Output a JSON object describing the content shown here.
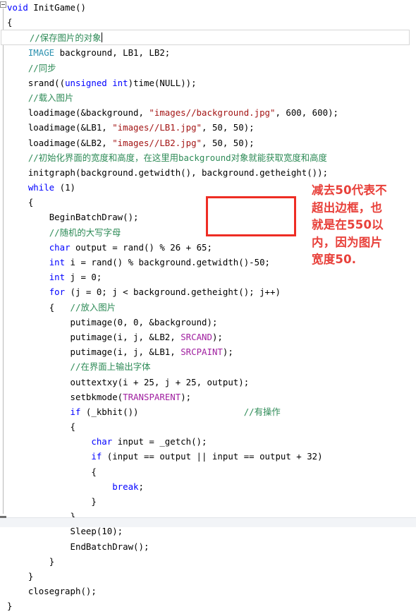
{
  "editor": {
    "language": "cpp",
    "colors": {
      "keyword": "#0000ff",
      "type": "#2b91af",
      "comment": "#2e8b57",
      "string": "#a31515",
      "macro": "#a020a0",
      "plain": "#000000",
      "annotation_red": "#e8403a",
      "highlight_border": "#d7d7d7",
      "background": "#ffffff"
    },
    "fold_icon": "collapse-minus-box-icon",
    "caret_line_index": 2
  },
  "code_lines": [
    {
      "indent": 0,
      "tokens": [
        {
          "t": "kw",
          "s": "void"
        },
        {
          "t": "plain",
          "s": " InitGame()"
        }
      ]
    },
    {
      "indent": 0,
      "tokens": [
        {
          "t": "plain",
          "s": "{"
        }
      ]
    },
    {
      "indent": 1,
      "current": true,
      "caret": true,
      "tokens": [
        {
          "t": "cmt",
          "s": "//保存图片的对象"
        }
      ]
    },
    {
      "indent": 1,
      "tokens": [
        {
          "t": "type",
          "s": "IMAGE"
        },
        {
          "t": "plain",
          "s": " background, LB1, LB2;"
        }
      ]
    },
    {
      "indent": 1,
      "tokens": [
        {
          "t": "cmt",
          "s": "//同步"
        }
      ]
    },
    {
      "indent": 1,
      "tokens": [
        {
          "t": "plain",
          "s": "srand(("
        },
        {
          "t": "kw",
          "s": "unsigned"
        },
        {
          "t": "plain",
          "s": " "
        },
        {
          "t": "kw",
          "s": "int"
        },
        {
          "t": "plain",
          "s": ")time(NULL));"
        }
      ]
    },
    {
      "indent": 1,
      "tokens": [
        {
          "t": "cmt",
          "s": "//载入图片"
        }
      ]
    },
    {
      "indent": 1,
      "tokens": [
        {
          "t": "plain",
          "s": "loadimage(&background, "
        },
        {
          "t": "str",
          "s": "\"images//background.jpg\""
        },
        {
          "t": "plain",
          "s": ", 600, 600);"
        }
      ]
    },
    {
      "indent": 1,
      "tokens": [
        {
          "t": "plain",
          "s": "loadimage(&LB1, "
        },
        {
          "t": "str",
          "s": "\"images//LB1.jpg\""
        },
        {
          "t": "plain",
          "s": ", 50, 50);"
        }
      ]
    },
    {
      "indent": 1,
      "tokens": [
        {
          "t": "plain",
          "s": "loadimage(&LB2, "
        },
        {
          "t": "str",
          "s": "\"images//LB2.jpg\""
        },
        {
          "t": "plain",
          "s": ", 50, 50);"
        }
      ]
    },
    {
      "indent": 1,
      "tokens": [
        {
          "t": "cmt",
          "s": "//初始化界面的宽度和高度，在这里用background对象就能获取宽度和高度"
        }
      ]
    },
    {
      "indent": 1,
      "tokens": [
        {
          "t": "plain",
          "s": "initgraph(background.getwidth(), background.getheight());"
        }
      ]
    },
    {
      "indent": 1,
      "tokens": [
        {
          "t": "kw",
          "s": "while"
        },
        {
          "t": "plain",
          "s": " (1)"
        }
      ]
    },
    {
      "indent": 1,
      "tokens": [
        {
          "t": "plain",
          "s": "{"
        }
      ]
    },
    {
      "indent": 2,
      "tokens": [
        {
          "t": "plain",
          "s": "BeginBatchDraw();"
        }
      ]
    },
    {
      "indent": 2,
      "tokens": [
        {
          "t": "cmt",
          "s": "//随机的大写字母"
        }
      ]
    },
    {
      "indent": 2,
      "tokens": [
        {
          "t": "kw",
          "s": "char"
        },
        {
          "t": "plain",
          "s": " output = rand() % 26 + 65;"
        }
      ]
    },
    {
      "indent": 2,
      "tokens": [
        {
          "t": "kw",
          "s": "int"
        },
        {
          "t": "plain",
          "s": " i = rand() % background.getwidth()-50;"
        }
      ]
    },
    {
      "indent": 2,
      "tokens": [
        {
          "t": "kw",
          "s": "int"
        },
        {
          "t": "plain",
          "s": " j = 0;"
        }
      ]
    },
    {
      "indent": 2,
      "tokens": [
        {
          "t": "kw",
          "s": "for"
        },
        {
          "t": "plain",
          "s": " (j = 0; j < background.getheight(); j++)"
        }
      ]
    },
    {
      "indent": 2,
      "tokens": [
        {
          "t": "plain",
          "s": "{   "
        },
        {
          "t": "cmt",
          "s": "//放入图片"
        }
      ]
    },
    {
      "indent": 3,
      "tokens": [
        {
          "t": "plain",
          "s": "putimage(0, 0, &background);"
        }
      ]
    },
    {
      "indent": 3,
      "tokens": [
        {
          "t": "plain",
          "s": "putimage(i, j, &LB2, "
        },
        {
          "t": "macro",
          "s": "SRCAND"
        },
        {
          "t": "plain",
          "s": ");"
        }
      ]
    },
    {
      "indent": 3,
      "tokens": [
        {
          "t": "plain",
          "s": "putimage(i, j, &LB1, "
        },
        {
          "t": "macro",
          "s": "SRCPAINT"
        },
        {
          "t": "plain",
          "s": ");"
        }
      ]
    },
    {
      "indent": 3,
      "tokens": [
        {
          "t": "cmt",
          "s": "//在界面上输出字体"
        }
      ]
    },
    {
      "indent": 3,
      "tokens": [
        {
          "t": "plain",
          "s": "outtextxy(i + 25, j + 25, output);"
        }
      ]
    },
    {
      "indent": 3,
      "tokens": [
        {
          "t": "plain",
          "s": "setbkmode("
        },
        {
          "t": "macro",
          "s": "TRANSPARENT"
        },
        {
          "t": "plain",
          "s": ");"
        }
      ]
    },
    {
      "indent": 3,
      "tokens": [
        {
          "t": "kw",
          "s": "if"
        },
        {
          "t": "plain",
          "s": " (_kbhit())"
        },
        {
          "t": "plain",
          "s": "                    "
        },
        {
          "t": "cmt",
          "s": "//有操作"
        }
      ]
    },
    {
      "indent": 3,
      "tokens": [
        {
          "t": "plain",
          "s": "{"
        }
      ]
    },
    {
      "indent": 4,
      "tokens": [
        {
          "t": "kw",
          "s": "char"
        },
        {
          "t": "plain",
          "s": " input = _getch();"
        }
      ]
    },
    {
      "indent": 4,
      "tokens": [
        {
          "t": "kw",
          "s": "if"
        },
        {
          "t": "plain",
          "s": " (input == output || input == output + 32)"
        }
      ]
    },
    {
      "indent": 4,
      "tokens": [
        {
          "t": "plain",
          "s": "{"
        }
      ]
    },
    {
      "indent": 5,
      "tokens": [
        {
          "t": "kw",
          "s": "break"
        },
        {
          "t": "plain",
          "s": ";"
        }
      ]
    },
    {
      "indent": 4,
      "tokens": [
        {
          "t": "plain",
          "s": "}"
        }
      ]
    },
    {
      "indent": 3,
      "tokens": [
        {
          "t": "plain",
          "s": "}"
        }
      ]
    },
    {
      "indent": 3,
      "tokens": [
        {
          "t": "plain",
          "s": "Sleep(10);"
        }
      ]
    },
    {
      "indent": 3,
      "tokens": [
        {
          "t": "plain",
          "s": "EndBatchDraw();"
        }
      ]
    },
    {
      "indent": 2,
      "tokens": [
        {
          "t": "plain",
          "s": "}"
        }
      ]
    },
    {
      "indent": 1,
      "tokens": [
        {
          "t": "plain",
          "s": "}"
        }
      ]
    },
    {
      "indent": 1,
      "tokens": [
        {
          "t": "plain",
          "s": "closegraph();"
        }
      ]
    },
    {
      "indent": 0,
      "tokens": [
        {
          "t": "plain",
          "s": "}"
        }
      ]
    }
  ],
  "annotation": {
    "note_text": "减去50代表不\n超出边框，也\n就是在550以\n内，因为图片\n宽度50.",
    "box_label": "red-highlight-rectangle"
  }
}
